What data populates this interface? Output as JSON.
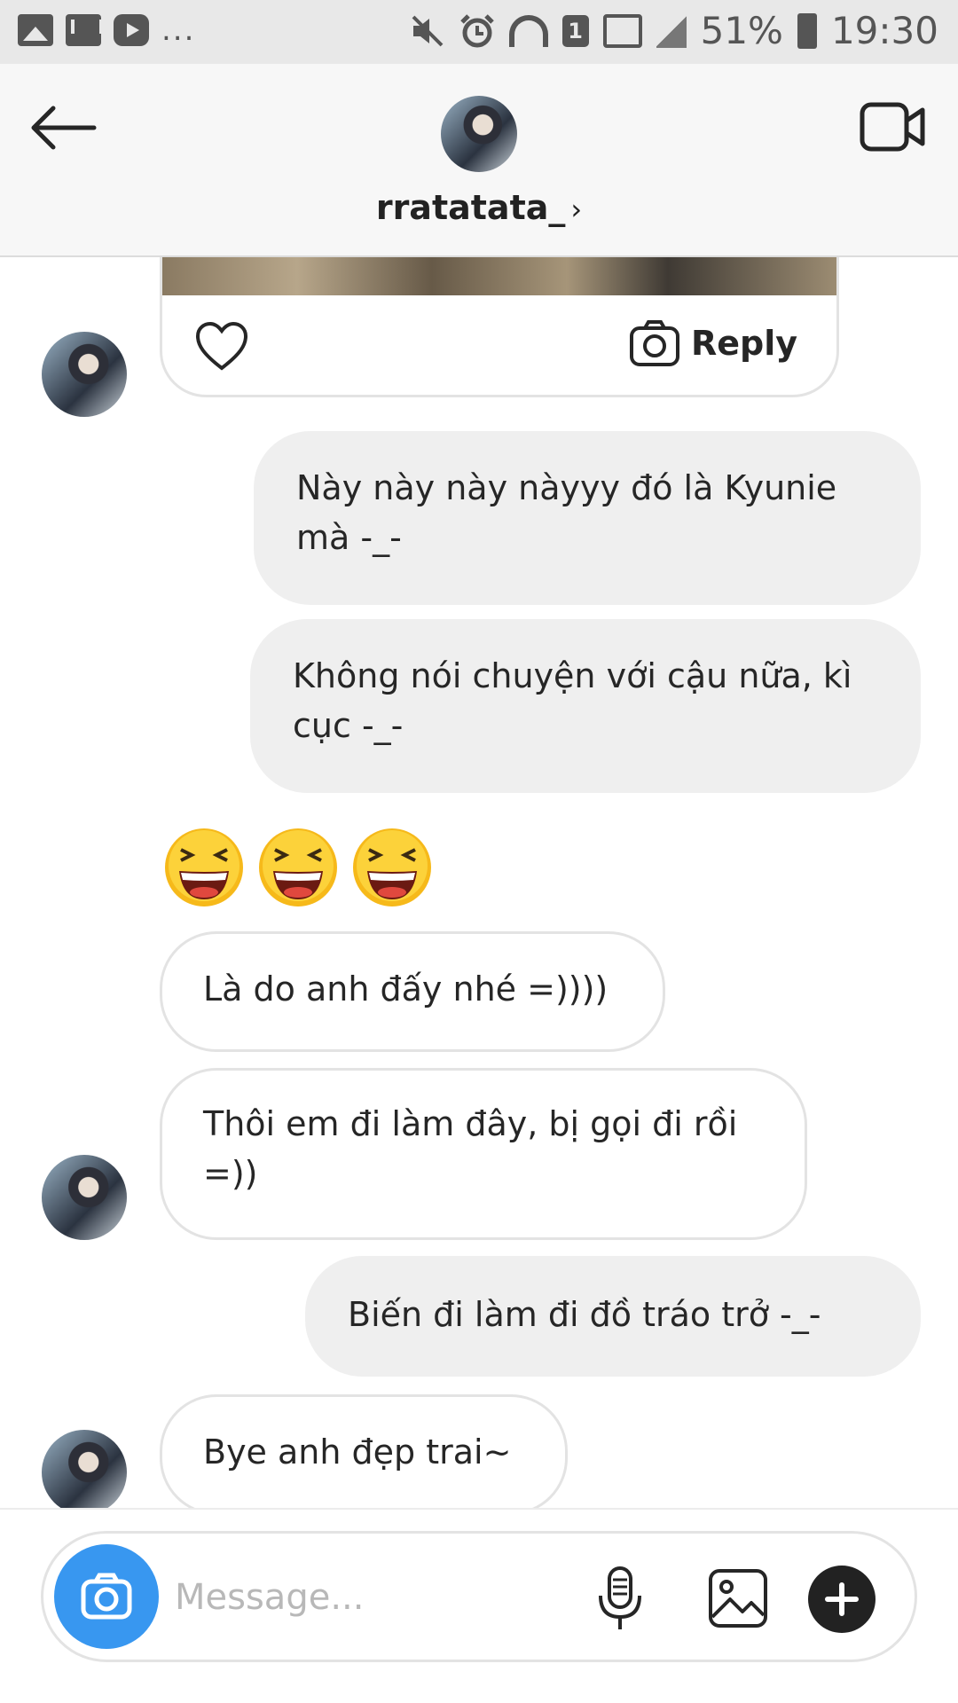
{
  "status_bar": {
    "battery_percent": "51%",
    "time": "19:30",
    "notification_badge": "1",
    "more_dots": "...",
    "icons": [
      "image-icon",
      "mail-icon",
      "youtube-icon",
      "mute-icon",
      "alarm-icon",
      "wifi-icon",
      "signal-icon",
      "battery-icon"
    ]
  },
  "header": {
    "username": "rratatata_",
    "chevron": "›",
    "icons": [
      "back-arrow-icon",
      "video-call-icon"
    ]
  },
  "story_reply_card": {
    "reply_label": "Reply",
    "icons": [
      "heart-icon",
      "camera-icon"
    ]
  },
  "messages": [
    {
      "id": "m1",
      "direction": "outgoing",
      "text": "Này này này nàyyy đó là Kyunie mà -_-"
    },
    {
      "id": "m2",
      "direction": "outgoing",
      "text": "Không nói chuyện với cậu nữa, kì cục -_-"
    },
    {
      "id": "m3",
      "direction": "incoming",
      "text": "😆😆😆"
    },
    {
      "id": "m4",
      "direction": "incoming",
      "text": "Là do anh đấy nhé =))))"
    },
    {
      "id": "m5",
      "direction": "incoming",
      "text": "Thôi em đi làm đây, bị gọi đi rồi =))"
    },
    {
      "id": "m6",
      "direction": "outgoing",
      "text": "Biến đi làm đi đồ tráo trở -_-"
    },
    {
      "id": "m7",
      "direction": "incoming",
      "text": "Bye anh đẹp trai~"
    }
  ],
  "composer": {
    "placeholder": "Message...",
    "icons": [
      "camera-icon",
      "microphone-icon",
      "gallery-icon",
      "plus-icon"
    ]
  },
  "colors": {
    "accent_blue": "#3897f0",
    "outgoing_bubble": "#efefef",
    "incoming_border": "#e3e3e3",
    "status_bar_bg": "#e8e8e8"
  }
}
